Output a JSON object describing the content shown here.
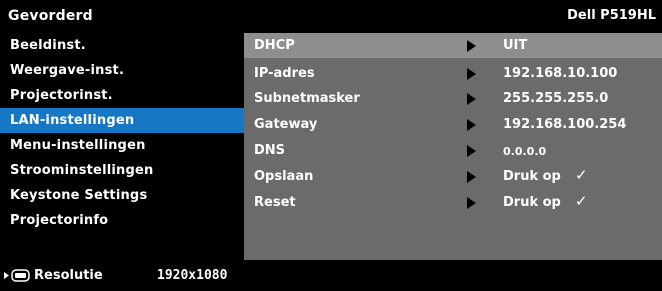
{
  "header": {
    "title": "Gevorderd",
    "model": "Dell P519HL"
  },
  "menu": [
    {
      "label": "Beeldinst.",
      "active": false
    },
    {
      "label": "Weergave-inst.",
      "active": false
    },
    {
      "label": "Projectorinst.",
      "active": false
    },
    {
      "label": "LAN-instellingen",
      "active": true
    },
    {
      "label": "Menu-instellingen",
      "active": false
    },
    {
      "label": "Stroominstellingen",
      "active": false
    },
    {
      "label": "Keystone Settings",
      "active": false
    },
    {
      "label": "Projectorinfo",
      "active": false
    }
  ],
  "settings": [
    {
      "label": "DHCP",
      "value": "UIT"
    },
    {
      "label": "IP-adres",
      "value": "192.168.10.100"
    },
    {
      "label": "Subnetmasker",
      "value": "255.255.255.0"
    },
    {
      "label": "Gateway",
      "value": "192.168.100.254"
    },
    {
      "label": "DNS",
      "value": "0.0.0.0"
    },
    {
      "label": "Opslaan",
      "value": "Druk op",
      "check": "✓"
    },
    {
      "label": "Reset",
      "value": "Druk op",
      "check": "✓"
    }
  ],
  "footer": {
    "label": "Resolutie",
    "value": "1920x1080"
  },
  "colors": {
    "accent": "#1677c4",
    "panel": "#6b6b6b",
    "row_highlight": "#8e8e8e"
  }
}
